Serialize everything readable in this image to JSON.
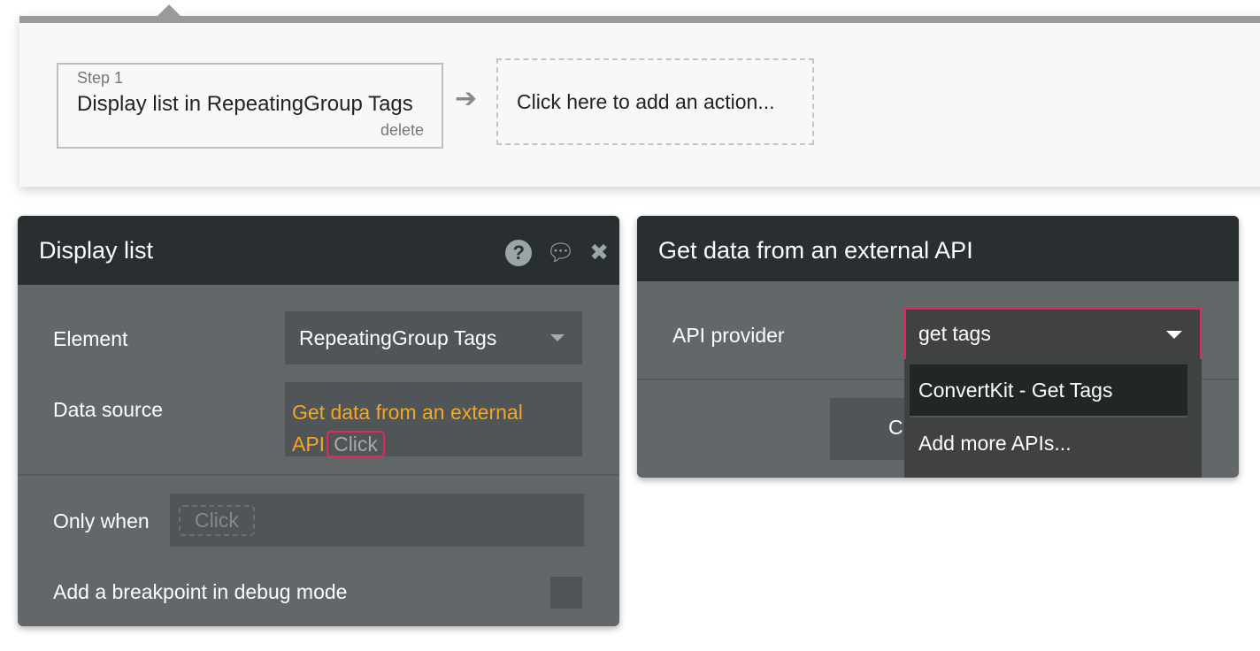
{
  "workflow": {
    "step_number": "Step 1",
    "step_title": "Display list in RepeatingGroup Tags",
    "delete_label": "delete",
    "add_action": "Click here to add an action..."
  },
  "display_list": {
    "title": "Display list",
    "element_label": "Element",
    "element_value": "RepeatingGroup Tags",
    "data_source_label": "Data source",
    "data_source_value": "Get data from an external API",
    "data_source_click": "Click",
    "only_when_label": "Only when",
    "only_when_click": "Click",
    "breakpoint_label": "Add a breakpoint in debug mode",
    "breakpoint_checked": false,
    "highlight_color": "#f5a623",
    "error_color": "#e8265e"
  },
  "api_panel": {
    "title": "Get data from an external API",
    "provider_label": "API provider",
    "provider_value": "get tags",
    "button_visible_text": "C",
    "options": [
      {
        "label": "ConvertKit - Get Tags"
      },
      {
        "label": "Add more APIs..."
      }
    ]
  }
}
